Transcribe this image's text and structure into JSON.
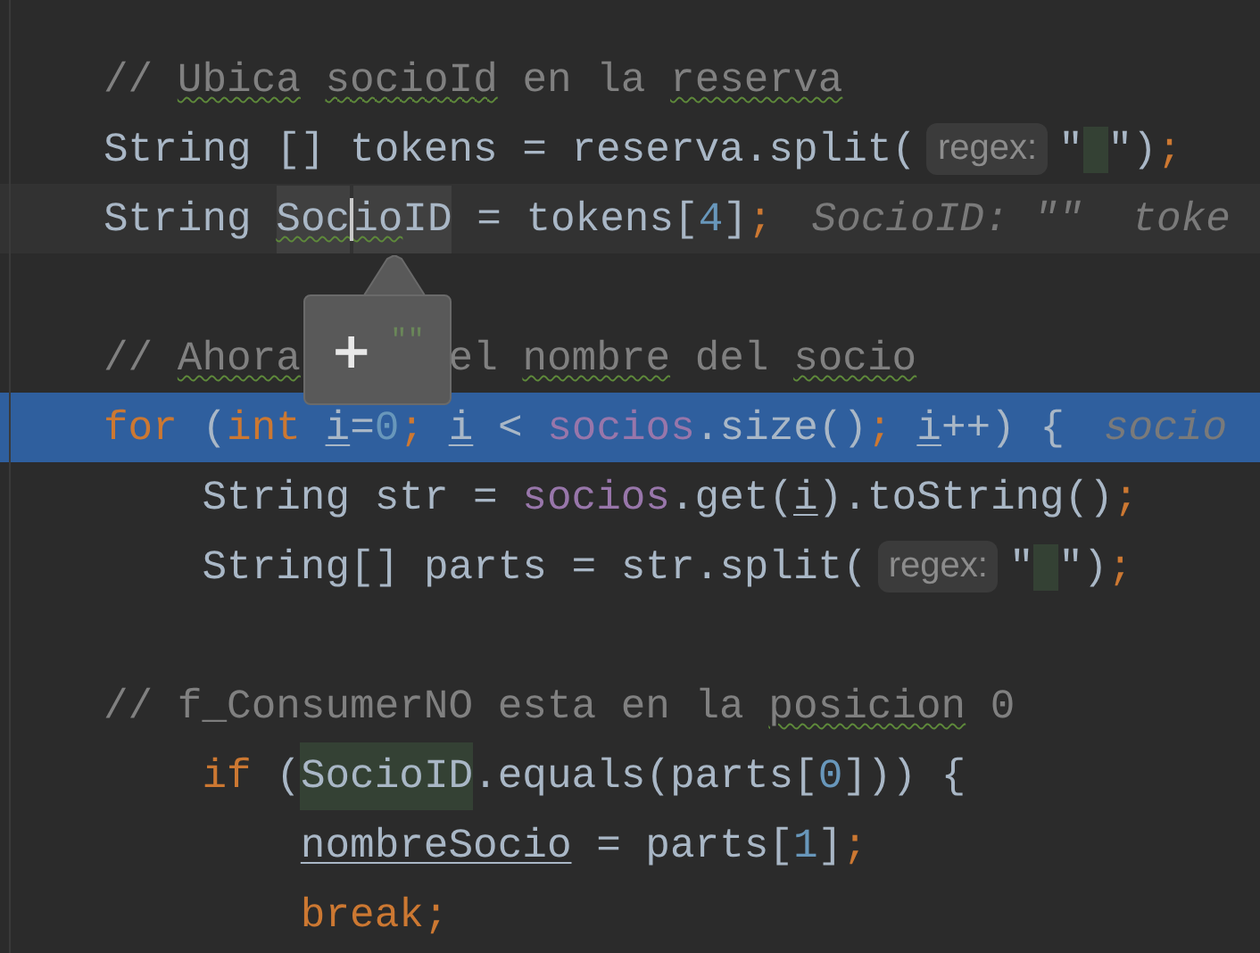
{
  "editor": {
    "lines": [
      {
        "selected": false,
        "tokens": [
          {
            "kind": "comment",
            "text": "//"
          },
          {
            "kind": "comment",
            "text": " Ubica",
            "typo": true
          },
          {
            "kind": "comment",
            "text": " socioId",
            "typo": true
          },
          {
            "kind": "comment",
            "text": " en la"
          },
          {
            "kind": "comment",
            "text": " reserva",
            "typo": true
          }
        ]
      },
      {
        "selected": false,
        "tokens": [
          {
            "kind": "plain",
            "text": "String [] tokens = reserva.split("
          },
          {
            "kind": "hint",
            "text": "regex:"
          },
          {
            "kind": "plain",
            "text": "\" \"",
            "match_inner": true
          },
          {
            "kind": "plain",
            "text": ")"
          },
          {
            "kind": "keyword",
            "text": ";"
          }
        ]
      },
      {
        "selected": false,
        "tokens": [
          {
            "kind": "plain",
            "text": "String "
          },
          {
            "kind": "plain",
            "text": "Soc",
            "typo": true,
            "caret_word": true
          },
          {
            "kind": "plain",
            "text": "io",
            "typo": true,
            "caret_word": true,
            "caret_before": true
          },
          {
            "kind": "plain",
            "text": "ID",
            "caret_word": true
          },
          {
            "kind": "plain",
            "text": " = tokens["
          },
          {
            "kind": "number",
            "text": "4"
          },
          {
            "kind": "plain",
            "text": "]"
          },
          {
            "kind": "keyword",
            "text": ";"
          },
          {
            "kind": "inline",
            "text": "SocioID: \"\"  toke"
          }
        ]
      },
      {
        "selected": false
      },
      {
        "selected": false,
        "tokens": [
          {
            "kind": "comment",
            "text": "//"
          },
          {
            "kind": "comment",
            "text": " Ahora",
            "typo": true
          },
          {
            "kind": "comment",
            "text": "      el"
          },
          {
            "kind": "comment",
            "text": " nombre",
            "typo": true
          },
          {
            "kind": "comment",
            "text": " del"
          },
          {
            "kind": "comment",
            "text": " socio",
            "typo": true
          }
        ]
      },
      {
        "selected": true,
        "tokens": [
          {
            "kind": "keyword",
            "text": "for "
          },
          {
            "kind": "plain",
            "text": "("
          },
          {
            "kind": "keyword",
            "text": "int "
          },
          {
            "kind": "plain",
            "text": "i",
            "underline": true
          },
          {
            "kind": "plain",
            "text": "="
          },
          {
            "kind": "number",
            "text": "0"
          },
          {
            "kind": "keyword",
            "text": "; "
          },
          {
            "kind": "plain",
            "text": "i",
            "underline": true
          },
          {
            "kind": "plain",
            "text": " < "
          },
          {
            "kind": "field",
            "text": "socios"
          },
          {
            "kind": "plain",
            "text": ".size()"
          },
          {
            "kind": "keyword",
            "text": "; "
          },
          {
            "kind": "plain",
            "text": "i",
            "underline": true
          },
          {
            "kind": "plain",
            "text": "++) {"
          },
          {
            "kind": "inline",
            "text": "socio"
          }
        ]
      },
      {
        "selected": false,
        "tokens": [
          {
            "kind": "plain",
            "text": "    String str = "
          },
          {
            "kind": "field",
            "text": "socios"
          },
          {
            "kind": "plain",
            "text": ".get("
          },
          {
            "kind": "plain",
            "text": "i",
            "underline": true
          },
          {
            "kind": "plain",
            "text": ").toString()"
          },
          {
            "kind": "keyword",
            "text": ";"
          }
        ]
      },
      {
        "selected": false,
        "tokens": [
          {
            "kind": "plain",
            "text": "    String[] parts = str.split("
          },
          {
            "kind": "hint",
            "text": "regex:"
          },
          {
            "kind": "plain",
            "text": "\" \"",
            "match_inner": true
          },
          {
            "kind": "plain",
            "text": ")"
          },
          {
            "kind": "keyword",
            "text": ";"
          }
        ]
      },
      {
        "selected": false
      },
      {
        "selected": false,
        "tokens": [
          {
            "kind": "comment",
            "text": "// f_ConsumerNO esta en la"
          },
          {
            "kind": "comment",
            "text": " posicion",
            "typo": true
          },
          {
            "kind": "comment",
            "text": " 0"
          }
        ]
      },
      {
        "selected": false,
        "tokens": [
          {
            "kind": "keyword",
            "text": "    if "
          },
          {
            "kind": "plain",
            "text": "("
          },
          {
            "kind": "plain",
            "text": "SocioID",
            "usage_highlight": true
          },
          {
            "kind": "plain",
            "text": ".equals(parts["
          },
          {
            "kind": "number",
            "text": "0"
          },
          {
            "kind": "plain",
            "text": "])) {"
          }
        ]
      },
      {
        "selected": false,
        "tokens": [
          {
            "kind": "plain",
            "text": "        nombreSocio",
            "underline": true
          },
          {
            "kind": "plain",
            "text": " = parts["
          },
          {
            "kind": "number",
            "text": "1"
          },
          {
            "kind": "plain",
            "text": "]"
          },
          {
            "kind": "keyword",
            "text": ";"
          }
        ]
      },
      {
        "selected": false,
        "tokens": [
          {
            "kind": "keyword",
            "text": "        break;"
          }
        ]
      }
    ]
  },
  "popup": {
    "icon": "+",
    "value": "\"\""
  }
}
